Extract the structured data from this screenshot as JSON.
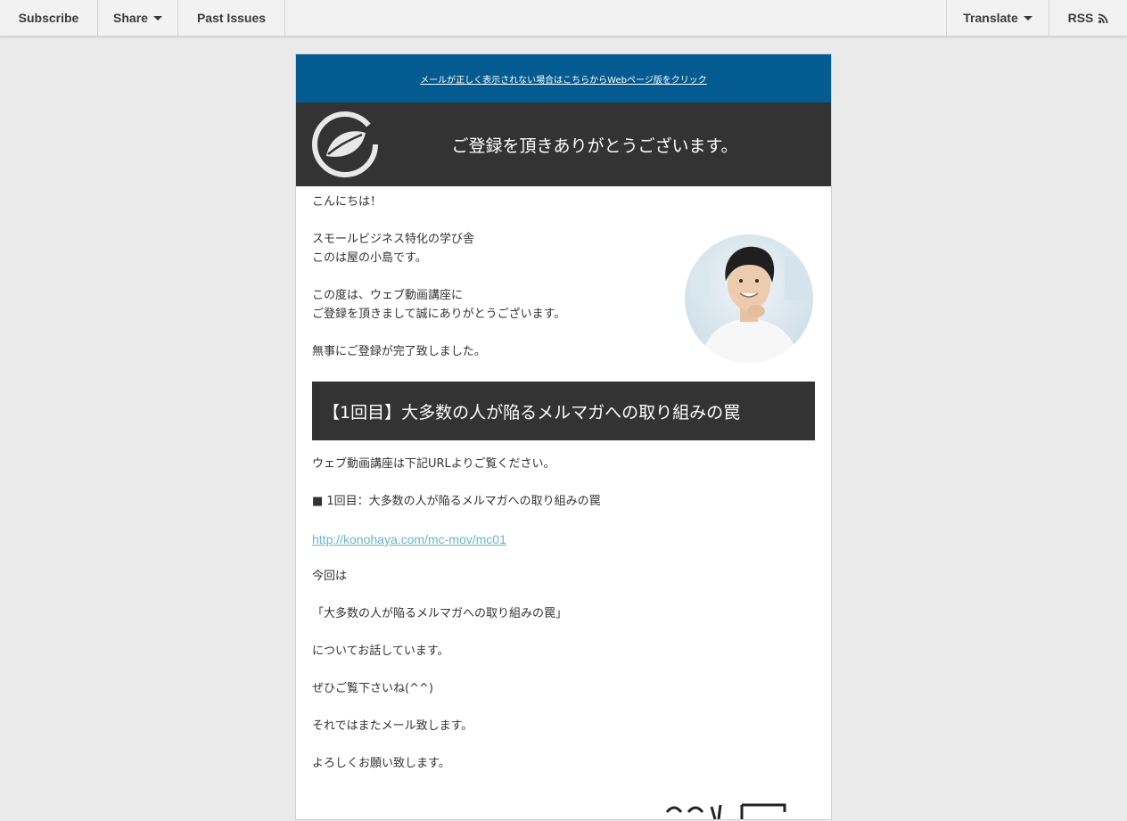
{
  "topbar": {
    "subscribe": "Subscribe",
    "share": "Share",
    "past_issues": "Past Issues",
    "translate": "Translate",
    "rss": "RSS"
  },
  "email": {
    "preheader_link": "メールが正しく表示されない場合はこちらからWebページ版をクリック",
    "header_title": "ご登録を頂きありがとうございます。",
    "greeting": "こんにちは！",
    "intro_line1": "スモールビジネス特化の学び舎",
    "intro_line2": "このは屋の小島です。",
    "thanks_line1": "この度は、ウェブ動画講座に",
    "thanks_line2": "ご登録を頂きまして誠にありがとうございます。",
    "complete": "無事にご登録が完了致しました。",
    "banner_title": "【1回目】大多数の人が陥るメルマガへの取り組みの罠",
    "url_intro": "ウェブ動画講座は下記URLよりご覧ください。",
    "lesson_label": "■ 1回目：大多数の人が陥るメルマガへの取り組みの罠",
    "lesson_url": "http://konohaya.com/mc-mov/mc01",
    "this_time": "今回は",
    "topic_quote": "「大多数の人が陥るメルマガへの取り組みの罠」",
    "talking": "についてお話しています。",
    "please_watch": "ぜひご覧下さいね(^^)",
    "until_next": "それではまたメール致します。",
    "regards": "よろしくお願い致します。"
  },
  "colors": {
    "preheader_bg": "#045b91",
    "header_bg": "#333333",
    "link": "#6ab4c9",
    "page_bg": "#eaeaea"
  },
  "icons": [
    "caret-down-icon",
    "rss-icon",
    "leaf-logo-icon"
  ]
}
